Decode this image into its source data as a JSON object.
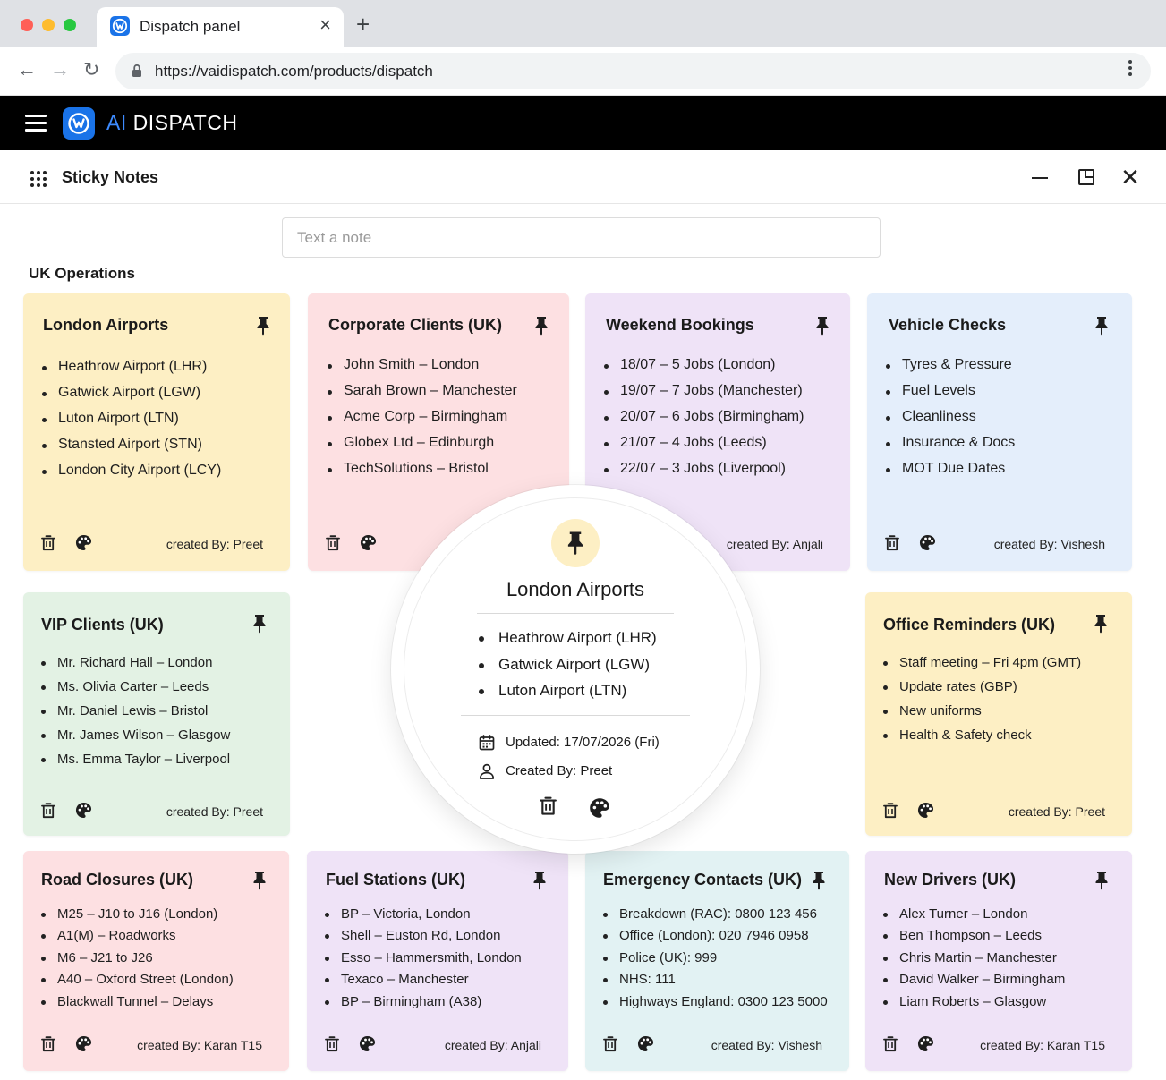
{
  "browser": {
    "tab_title": "Dispatch panel",
    "close_glyph": "×",
    "new_tab_glyph": "+",
    "url": "https://vaidispatch.com/products/dispatch",
    "back_glyph": "←",
    "forward_glyph": "→",
    "reload_glyph": "↻"
  },
  "app": {
    "brand_prefix": "AI",
    "brand_name": "DISPATCH"
  },
  "panel": {
    "title": "Sticky Notes",
    "close_glyph": "✕"
  },
  "note_input": {
    "placeholder": "Text a note",
    "value": ""
  },
  "section": {
    "title": "UK Operations"
  },
  "colors": {
    "yellow": "#fdefc4",
    "pink": "#fde0e2",
    "lavender": "#efe3f7",
    "blue": "#e4eefb",
    "green": "#e3f2e4",
    "teal": "#e2f2f3",
    "brand_blue": "#1a73e8"
  },
  "notes": [
    {
      "title": "London Airports",
      "color": "yellow",
      "items": [
        "Heathrow Airport (LHR)",
        "Gatwick Airport (LGW)",
        "Luton Airport (LTN)",
        "Stansted Airport (STN)",
        "London City Airport (LCY)"
      ],
      "created_by": "created By: Preet"
    },
    {
      "title": "Corporate Clients (UK)",
      "color": "pink",
      "items": [
        "John Smith – London",
        "Sarah Brown – Manchester",
        "Acme Corp – Birmingham",
        "Globex Ltd – Edinburgh",
        "TechSolutions – Bristol"
      ],
      "created_by": ""
    },
    {
      "title": "Weekend Bookings",
      "color": "lavender",
      "items": [
        "18/07 – 5 Jobs (London)",
        "19/07 – 7 Jobs (Manchester)",
        "20/07 – 6 Jobs (Birmingham)",
        "21/07 – 4 Jobs (Leeds)",
        "22/07 – 3 Jobs (Liverpool)"
      ],
      "created_by": "created By: Anjali"
    },
    {
      "title": "Vehicle Checks",
      "color": "blue",
      "items": [
        "Tyres & Pressure",
        "Fuel Levels",
        "Cleanliness",
        "Insurance & Docs",
        "MOT Due Dates"
      ],
      "created_by": "created By: Vishesh"
    },
    {
      "title": "VIP Clients (UK)",
      "color": "green",
      "items": [
        "Mr. Richard Hall – London",
        "Ms. Olivia Carter – Leeds",
        "Mr. Daniel Lewis – Bristol",
        "Mr. James Wilson – Glasgow",
        "Ms. Emma Taylor – Liverpool"
      ],
      "created_by": "created By: Preet"
    },
    {
      "title": "Office Reminders (UK)",
      "color": "yellow",
      "items": [
        "Staff meeting – Fri 4pm (GMT)",
        "Update rates (GBP)",
        "New uniforms",
        "Health & Safety check"
      ],
      "created_by": "created By: Preet"
    },
    {
      "title": "Road Closures (UK)",
      "color": "pink",
      "items": [
        "M25 – J10 to J16 (London)",
        "A1(M) – Roadworks",
        "M6 – J21 to J26",
        "A40 – Oxford Street (London)",
        "Blackwall Tunnel – Delays"
      ],
      "created_by": "created By: Karan T15"
    },
    {
      "title": "Fuel Stations (UK)",
      "color": "lavender",
      "items": [
        "BP – Victoria, London",
        "Shell – Euston Rd, London",
        "Esso – Hammersmith, London",
        "Texaco – Manchester",
        "BP – Birmingham (A38)"
      ],
      "created_by": "created By: Anjali"
    },
    {
      "title": "Emergency Contacts (UK)",
      "color": "teal",
      "items": [
        "Breakdown (RAC): 0800 123 456",
        "Office (London): 020 7946 0958",
        "Police (UK): 999",
        "NHS: 111",
        "Highways England: 0300 123 5000"
      ],
      "created_by": "created By: Vishesh"
    },
    {
      "title": "New Drivers (UK)",
      "color": "lavender",
      "items": [
        "Alex Turner – London",
        "Ben Thompson – Leeds",
        "Chris Martin – Manchester",
        "David Walker – Birmingham",
        "Liam Roberts – Glasgow"
      ],
      "created_by": "created By: Karan T15"
    }
  ],
  "detail": {
    "title": "London Airports",
    "items": [
      "Heathrow Airport (LHR)",
      "Gatwick Airport (LGW)",
      "Luton Airport (LTN)"
    ],
    "updated": "Updated: 17/07/2026 (Fri)",
    "created_by": "Created By: Preet"
  }
}
